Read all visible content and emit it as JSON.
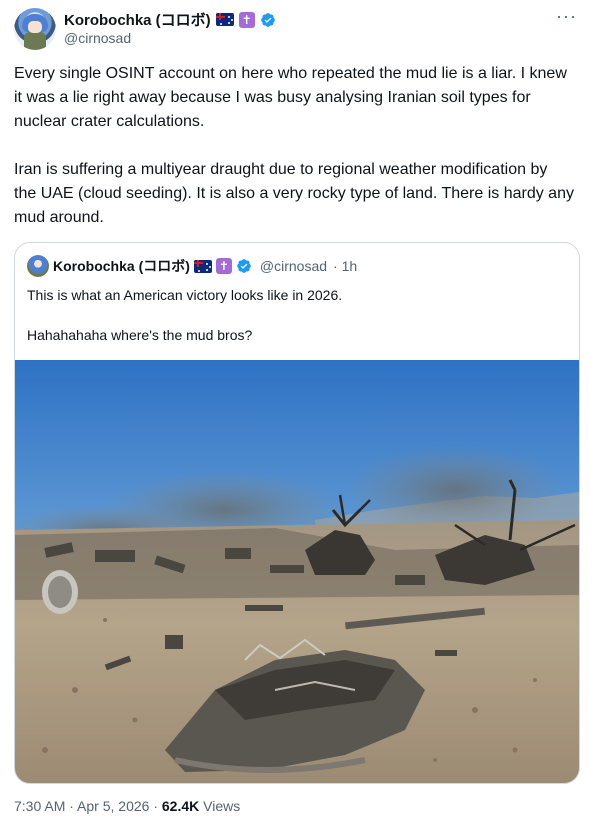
{
  "author": {
    "display_name": "Korobochka (コロボ)",
    "handle": "@cirnosad",
    "badges": [
      "australia-flag-icon",
      "latin-cross-icon",
      "verified-badge-icon"
    ],
    "cross_glyph": "✝"
  },
  "more_label": "···",
  "tweet": {
    "paragraphs": [
      "Every single OSINT account on here who repeated the mud lie is a liar. I knew it was a lie right away because I was busy analysing Iranian soil types for nuclear crater calculations.",
      "Iran is suffering a multiyear draught due to regional weather modification by the UAE (cloud seeding). It is also a very rocky type of land. There is hardy any mud around."
    ]
  },
  "quote": {
    "display_name": "Korobochka (コロボ)",
    "handle": "@cirnosad",
    "age": "· 1h",
    "paragraphs": [
      "This is what an American victory looks like in 2026.",
      "Hahahahaha where's the mud bros?"
    ],
    "photo_icon": "aircraft-wreckage-photo"
  },
  "footer": {
    "time": "7:30 AM",
    "sep1": " · ",
    "date": "Apr 5, 2026",
    "sep2": " · ",
    "views_count": "62.4K",
    "views_label": " Views"
  },
  "colors": {
    "text": "#0f1419",
    "secondary": "#536471",
    "verified": "#1d9bf0",
    "border": "#cfd9de"
  }
}
